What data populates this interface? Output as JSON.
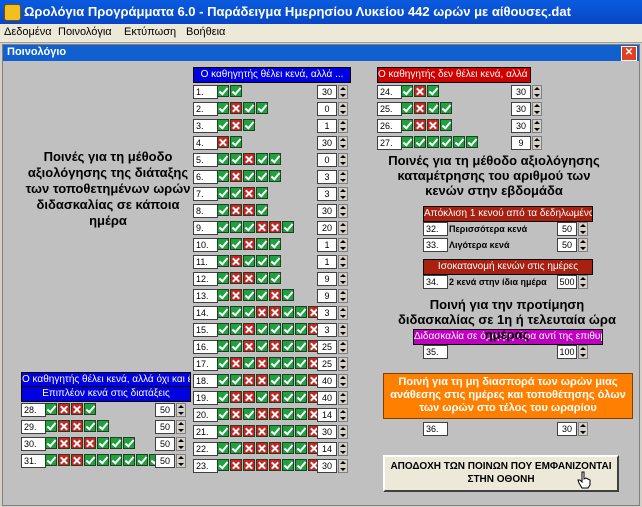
{
  "window": {
    "title": "Ωρολόγια Προγράμματα 6.0 - Παράδειγμα Ημερησίου Λυκείου 442 ωρών με αίθουσες.dat"
  },
  "menu": [
    "Δεδομένα",
    "Ποινολόγια",
    "Εκτύπωση",
    "Βοήθεια"
  ],
  "child": {
    "title": "Ποινολόγιο"
  },
  "headers": {
    "wants_gaps": "Ο καθηγητής θέλει κενά, αλλά ...",
    "no_gaps": "Ο καθηγητής δεν θέλει κενά, αλλά ...",
    "wants_gaps_not_all": "Ο καθηγητής θέλει κενά, αλλά όχι και έτσι ...",
    "extra_gaps": "Επιπλέον κενά στις διατάξεις",
    "deviation": "Απόκλιση 1 κενού από τα δεδηλωμένα",
    "equal": "Ισοκατανομή κενών στις ημέρες",
    "adjacent": "Διδασκαλία σε όμορρη ώρα αντί της επιθυμητής"
  },
  "texts": {
    "left_big": "Ποινές για τη μέθοδο αξιολόγησης της διάταξης των τοποθετημένων ωρών διδασκαλίας σε κάποια ημέρα",
    "right_big": "Ποινές για τη μέθοδο αξιολόγησης καταμέτρησης του αριθμού των κενών στην εβδομάδα",
    "first_last": "Ποινή για την προτίμηση διδασκαλίας σε 1η ή τελευταία ώρα ημέρας",
    "orange": "Ποινή για τη μη διασπορά των ωρών μιας ανάθεσης στις ημέρες και τοποθέτησης όλων των ωρών στο τέλος του ωραρίου",
    "ok_button": "ΑΠΟΔΟΧΗ ΤΩΝ ΠΟΙΝΩΝ ΠΟΥ ΕΜΦΑΝΙΖΟΝΤΑΙ ΣΤΗΝ ΟΘΟΝΗ",
    "more_gaps": "Περισσότερα κενά",
    "less_gaps": "Λιγότερα κενά",
    "two_gaps_same_day": "2 κενά στην ίδια ημέρα"
  },
  "mid_rows": [
    {
      "n": "1.",
      "v": "30",
      "p": "gg"
    },
    {
      "n": "2.",
      "v": "0",
      "p": "grgg"
    },
    {
      "n": "3.",
      "v": "1",
      "p": "grg"
    },
    {
      "n": "4.",
      "v": "30",
      "p": "rg"
    },
    {
      "n": "5.",
      "v": "0",
      "p": "ggrgg"
    },
    {
      "n": "6.",
      "v": "3",
      "p": "grggg"
    },
    {
      "n": "7.",
      "v": "3",
      "p": "ggrg"
    },
    {
      "n": "8.",
      "v": "30",
      "p": "grrg"
    },
    {
      "n": "9.",
      "v": "20",
      "p": "gggrrg"
    },
    {
      "n": "10.",
      "v": "1",
      "p": "ggrgg"
    },
    {
      "n": "11.",
      "v": "1",
      "p": "grggg"
    },
    {
      "n": "12.",
      "v": "9",
      "p": "grrgg"
    },
    {
      "n": "13.",
      "v": "9",
      "p": "grggrg"
    },
    {
      "n": "14.",
      "v": "3",
      "p": "gggrrggr"
    },
    {
      "n": "15.",
      "v": "3",
      "p": "ggrggggr"
    },
    {
      "n": "16.",
      "v": "25",
      "p": "ggrgrggr"
    },
    {
      "n": "17.",
      "v": "25",
      "p": "grgrgggr"
    },
    {
      "n": "18.",
      "v": "40",
      "p": "ggrrgggr"
    },
    {
      "n": "19.",
      "v": "40",
      "p": "grrgrggr"
    },
    {
      "n": "20.",
      "v": "14",
      "p": "grgrrggr"
    },
    {
      "n": "21.",
      "v": "30",
      "p": "grrrgggr"
    },
    {
      "n": "22.",
      "v": "14",
      "p": "ggrrrggr"
    },
    {
      "n": "23.",
      "v": "30",
      "p": "grrrrggr"
    }
  ],
  "right_rows": [
    {
      "n": "24.",
      "v": "30",
      "p": "grg"
    },
    {
      "n": "25.",
      "v": "30",
      "p": "grgg"
    },
    {
      "n": "26.",
      "v": "30",
      "p": "grrg"
    },
    {
      "n": "27.",
      "v": "9",
      "p": "gggggg"
    }
  ],
  "left_rows": [
    {
      "n": "28.",
      "v": "50",
      "p": "grrg"
    },
    {
      "n": "29.",
      "v": "50",
      "p": "grrgg"
    },
    {
      "n": "30.",
      "v": "50",
      "p": "grrrggg"
    },
    {
      "n": "31.",
      "v": "50",
      "p": "grrgggggg"
    }
  ],
  "singles": {
    "r32": {
      "n": "32.",
      "v": "50"
    },
    "r33": {
      "n": "33.",
      "v": "50"
    },
    "r34": {
      "n": "34.",
      "v": "500"
    },
    "r35": {
      "n": "35.",
      "v": "100"
    },
    "r36": {
      "n": "36.",
      "v": "30"
    }
  },
  "colors": {
    "green": "#20a040",
    "red": "#d02020",
    "orange": "#ff8000",
    "blue_header": "#0000e0"
  }
}
